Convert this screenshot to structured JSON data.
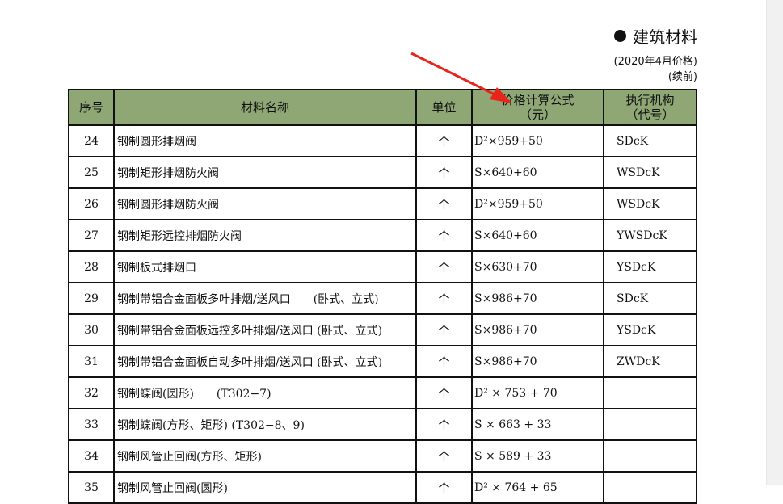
{
  "header": {
    "title": "建筑材料",
    "price_date": "(2020年4月价格)",
    "continued": "(续前)"
  },
  "table": {
    "headers": [
      "序号",
      "材料名称",
      "单位",
      "价格计算公式",
      "（元）",
      "执行机构",
      "（代号）"
    ],
    "rows": [
      {
        "no": "24",
        "name": "钢制圆形排烟阀",
        "unit": "个",
        "formula": "D²×959+50",
        "code": "SDcK"
      },
      {
        "no": "25",
        "name": "钢制矩形排烟防火阀",
        "unit": "个",
        "formula": "S×640+60",
        "code": "WSDcK"
      },
      {
        "no": "26",
        "name": "钢制圆形排烟防火阀",
        "unit": "个",
        "formula": "D²×959+50",
        "code": "WSDcK"
      },
      {
        "no": "27",
        "name": "钢制矩形远控排烟防火阀",
        "unit": "个",
        "formula": "S×640+60",
        "code": "YWSDcK"
      },
      {
        "no": "28",
        "name": "钢制板式排烟口",
        "unit": "个",
        "formula": "S×630+70",
        "code": "YSDcK"
      },
      {
        "no": "29",
        "name": "钢制带铝合金面板多叶排烟/送风口　　(卧式、立式)",
        "unit": "个",
        "formula": "S×986+70",
        "code": "SDcK"
      },
      {
        "no": "30",
        "name": "钢制带铝合金面板远控多叶排烟/送风口 (卧式、立式)",
        "unit": "个",
        "formula": "S×986+70",
        "code": "YSDcK"
      },
      {
        "no": "31",
        "name": "钢制带铝合金面板自动多叶排烟/送风口 (卧式、立式)",
        "unit": "个",
        "formula": "S×986+70",
        "code": "ZWDcK"
      },
      {
        "no": "32",
        "name": "钢制蝶阀(圆形)　　(T302−7)",
        "unit": "个",
        "formula": "D² × 753 + 70",
        "code": ""
      },
      {
        "no": "33",
        "name": "钢制蝶阀(方形、矩形) (T302−8、9)",
        "unit": "个",
        "formula": "S × 663 + 33",
        "code": ""
      },
      {
        "no": "34",
        "name": "钢制风管止回阀(方形、矩形)",
        "unit": "个",
        "formula": "S × 589 + 33",
        "code": ""
      },
      {
        "no": "35",
        "name": "钢制风管止回阀(圆形)",
        "unit": "个",
        "formula": "D² × 764 + 65",
        "code": ""
      }
    ]
  },
  "colors": {
    "header_bg": "#8fa775",
    "border": "#111111",
    "annotation_arrow": "#e8241c"
  }
}
